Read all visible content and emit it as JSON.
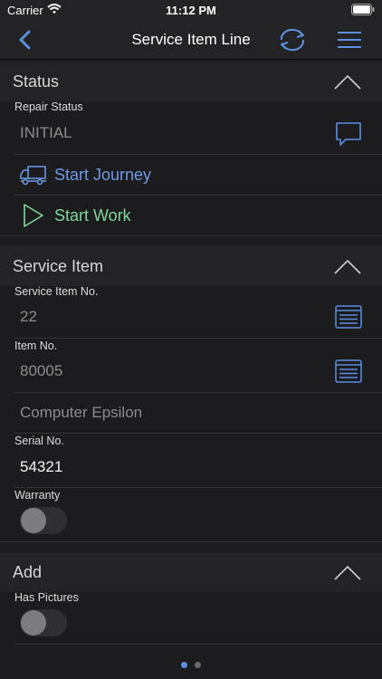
{
  "status_bar": {
    "carrier": "Carrier",
    "time": "11:12 PM"
  },
  "nav": {
    "title": "Service Item Line"
  },
  "sections": {
    "status": {
      "title": "Status",
      "repair_status_label": "Repair Status",
      "repair_status_value": "INITIAL",
      "start_journey": "Start Journey",
      "start_work": "Start Work"
    },
    "service_item": {
      "title": "Service Item",
      "service_item_no_label": "Service Item No.",
      "service_item_no_value": "22",
      "item_no_label": "Item No.",
      "item_no_value": "80005",
      "description_value": "Computer Epsilon",
      "serial_no_label": "Serial No.",
      "serial_no_value": "54321",
      "warranty_label": "Warranty",
      "warranty_on": false
    },
    "add": {
      "title": "Add",
      "has_pictures_label": "Has Pictures",
      "has_pictures_on": false
    }
  },
  "pager": {
    "pages": 2,
    "current": 1
  },
  "colors": {
    "accent_blue": "#5b8fe0",
    "action_blue": "#6f9be6",
    "action_green": "#7fd99a",
    "background": "#1c1c1e",
    "header": "#232325"
  },
  "icons": [
    "wifi-icon",
    "battery-icon",
    "back-chevron-icon",
    "sync-icon",
    "menu-icon",
    "chevron-up-icon",
    "comment-icon",
    "truck-icon",
    "play-icon",
    "list-lookup-icon"
  ]
}
